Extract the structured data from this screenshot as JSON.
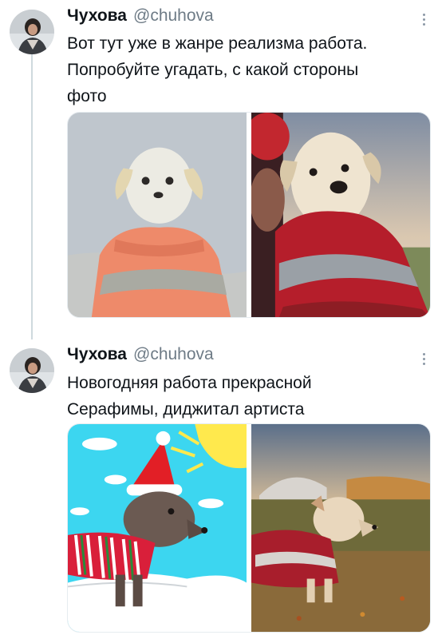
{
  "tweets": [
    {
      "author_name": "Чухова",
      "author_handle": "@chuhova",
      "text_lines": [
        "Вот тут уже в жанре реализма работа.",
        "Попробуйте угадать, с какой стороны",
        "фото"
      ],
      "images": [
        "pencil-drawing-of-dog-in-red-sweater",
        "photo-of-dog-in-red-sweater"
      ]
    },
    {
      "author_name": "Чухова",
      "author_handle": "@chuhova",
      "text_lines": [
        "Новогодняя работа прекрасной",
        "Серафимы, диджитал артиста"
      ],
      "images": [
        "digital-drawing-of-dog-in-santa-hat",
        "photo-of-dog-in-autumn-field"
      ]
    }
  ],
  "icons": {
    "more": "more-vertical-icon",
    "avatar": "avatar-image"
  },
  "colors": {
    "text": "#0f1419",
    "secondary": "#6e7b86",
    "thread_line": "#cfd9de",
    "icon_gray": "#8b98a5"
  }
}
